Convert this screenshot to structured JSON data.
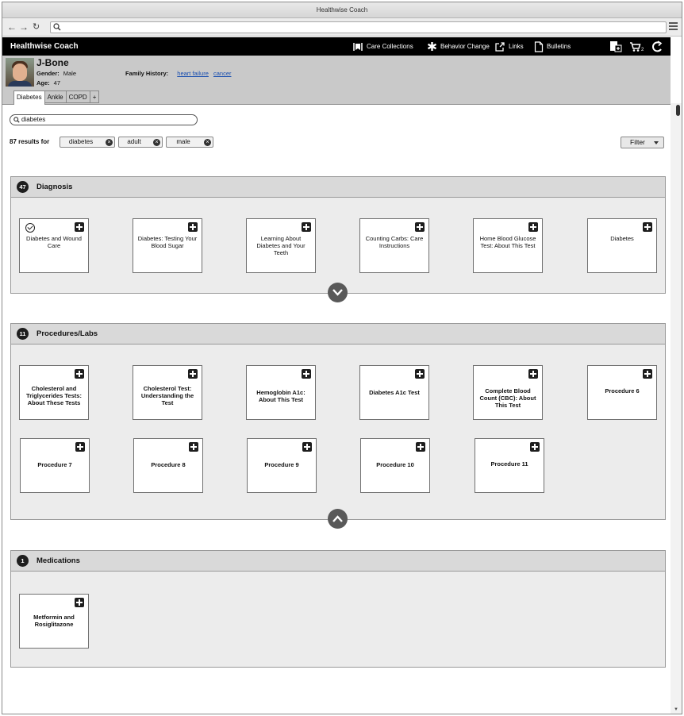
{
  "window": {
    "title": "Healthwise Coach"
  },
  "browser": {
    "url": ""
  },
  "app": {
    "brand": "Healthwise Coach",
    "nav": [
      {
        "label": "Care Collections",
        "icon": "care-collections-icon"
      },
      {
        "label": "Behavior Change",
        "icon": "behavior-change-icon"
      },
      {
        "label": "Links",
        "icon": "external-link-icon"
      },
      {
        "label": "Bulletins",
        "icon": "document-icon"
      }
    ],
    "cart_count": "2"
  },
  "patient": {
    "name": "J-Bone",
    "gender_label": "Gender:",
    "gender": "Male",
    "age_label": "Age:",
    "age": "47",
    "family_history_label": "Family History:",
    "family_history": [
      "heart failure",
      "cancer"
    ],
    "tabs": [
      "Diabetes",
      "Ankle",
      "COPD",
      "+"
    ],
    "active_tab": "Diabetes"
  },
  "search": {
    "value": "diabetes"
  },
  "results": {
    "text": "87 results for",
    "chips": [
      "diabetes",
      "adult",
      "male"
    ],
    "filter_label": "Filter"
  },
  "sections": [
    {
      "count": "47",
      "title": "Diagnosis",
      "state": "collapsed",
      "cards": [
        {
          "title": "Diabetes and Wound Care",
          "checked": true
        },
        {
          "title": "Diabetes: Testing Your Blood Sugar"
        },
        {
          "title": "Learning About Diabetes and Your Teeth"
        },
        {
          "title": "Counting Carbs: Care Instructions"
        },
        {
          "title": "Home Blood Glucose Test: About This Test"
        },
        {
          "title": "Diabetes"
        }
      ]
    },
    {
      "count": "11",
      "title": "Procedures/Labs",
      "state": "expanded",
      "cards": [
        {
          "title": "Cholesterol and Triglycerides Tests: About These Tests"
        },
        {
          "title": "Cholesterol Test: Understanding the Test"
        },
        {
          "title": "Hemoglobin A1c: About This Test"
        },
        {
          "title": "Diabetes A1c Test"
        },
        {
          "title": "Complete Blood Count (CBC): About This Test"
        },
        {
          "title": "Procedure 6"
        },
        {
          "title": "Procedure 7"
        },
        {
          "title": "Procedure 8"
        },
        {
          "title": "Procedure 9"
        },
        {
          "title": "Procedure 10"
        },
        {
          "title": "Procedure 11"
        }
      ]
    },
    {
      "count": "1",
      "title": "Medications",
      "cards": [
        {
          "title": "Metformin and Rosiglitazone"
        }
      ]
    }
  ]
}
